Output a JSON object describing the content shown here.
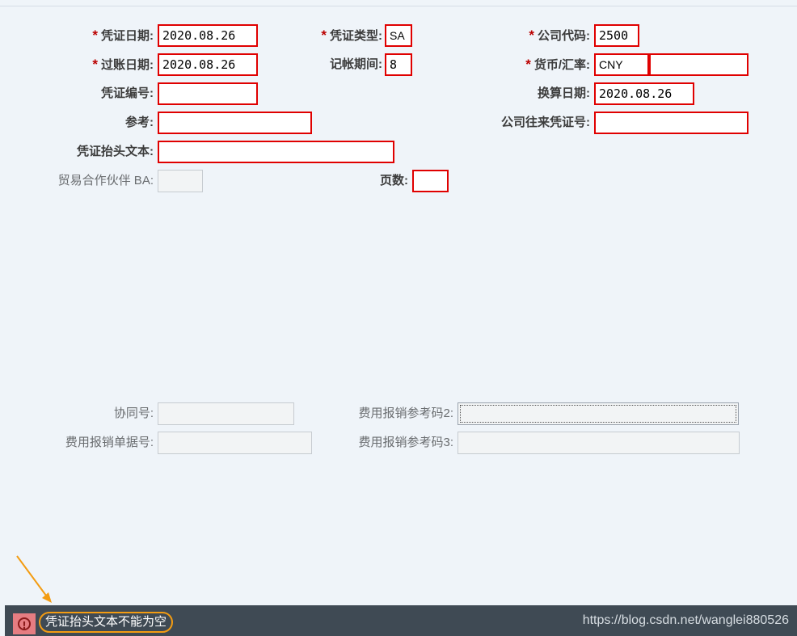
{
  "required_mark": "*",
  "fields": {
    "doc_date": {
      "label": "凭证日期:",
      "value": "2020.08.26"
    },
    "doc_type": {
      "label": "凭证类型:",
      "value": "SA"
    },
    "company_code": {
      "label": "公司代码:",
      "value": "2500"
    },
    "posting_date": {
      "label": "过账日期:",
      "value": "2020.08.26"
    },
    "period": {
      "label": "记帐期间:",
      "value": "8"
    },
    "currency": {
      "label": "货币/汇率:",
      "value": "CNY",
      "rate": ""
    },
    "doc_number": {
      "label": "凭证编号:",
      "value": ""
    },
    "translation_date": {
      "label": "换算日期:",
      "value": "2020.08.26"
    },
    "reference": {
      "label": "参考:",
      "value": ""
    },
    "intercompany_doc": {
      "label": "公司往来凭证号:",
      "value": ""
    },
    "header_text": {
      "label": "凭证抬头文本:",
      "value": ""
    },
    "trading_partner_ba": {
      "label": "贸易合作伙伴 BA:",
      "value": ""
    },
    "pages": {
      "label": "页数:",
      "value": ""
    },
    "agreement_no": {
      "label": "协同号:",
      "value": ""
    },
    "expense_ref2": {
      "label": "费用报销参考码2:",
      "value": ""
    },
    "expense_doc_no": {
      "label": "费用报销单据号:",
      "value": ""
    },
    "expense_ref3": {
      "label": "费用报销参考码3:",
      "value": ""
    }
  },
  "status": {
    "icon": "error-icon",
    "icon_glyph": "!",
    "message": "凭证抬头文本不能为空",
    "watermark": "https://blog.csdn.net/wanglei880526"
  },
  "colors": {
    "error_border": "#e00000",
    "required": "#bb0000",
    "annotation": "#f39c12",
    "statusbar": "#3f4a54"
  }
}
